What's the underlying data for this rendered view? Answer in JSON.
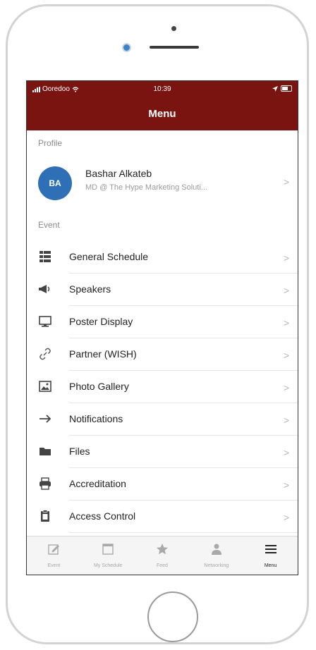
{
  "status": {
    "carrier": "Ooredoo",
    "time": "10:39"
  },
  "header": {
    "title": "Menu"
  },
  "profile": {
    "section_label": "Profile",
    "initials": "BA",
    "name": "Bashar Alkateb",
    "subtitle": "MD @ The Hype Marketing Soluti..."
  },
  "event": {
    "section_label": "Event",
    "items": [
      {
        "label": "General Schedule",
        "icon": "grid-calendar-icon"
      },
      {
        "label": "Speakers",
        "icon": "megaphone-icon"
      },
      {
        "label": "Poster Display",
        "icon": "monitor-icon"
      },
      {
        "label": "Partner (WISH)",
        "icon": "link-icon"
      },
      {
        "label": "Photo Gallery",
        "icon": "image-icon"
      },
      {
        "label": "Notifications",
        "icon": "arrow-right-icon"
      },
      {
        "label": "Files",
        "icon": "folder-icon"
      },
      {
        "label": "Accreditation",
        "icon": "printer-icon"
      },
      {
        "label": "Access Control",
        "icon": "clipboard-icon"
      }
    ]
  },
  "tabbar": {
    "items": [
      {
        "label": "Event",
        "icon": "edit-icon"
      },
      {
        "label": "My Schedule",
        "icon": "calendar-icon"
      },
      {
        "label": "Feed",
        "icon": "star-icon"
      },
      {
        "label": "Networking",
        "icon": "person-icon"
      },
      {
        "label": "Menu",
        "icon": "hamburger-icon"
      }
    ],
    "active": "Menu"
  },
  "colors": {
    "header_bg": "#7a1411",
    "avatar_bg": "#2f6fb5"
  }
}
